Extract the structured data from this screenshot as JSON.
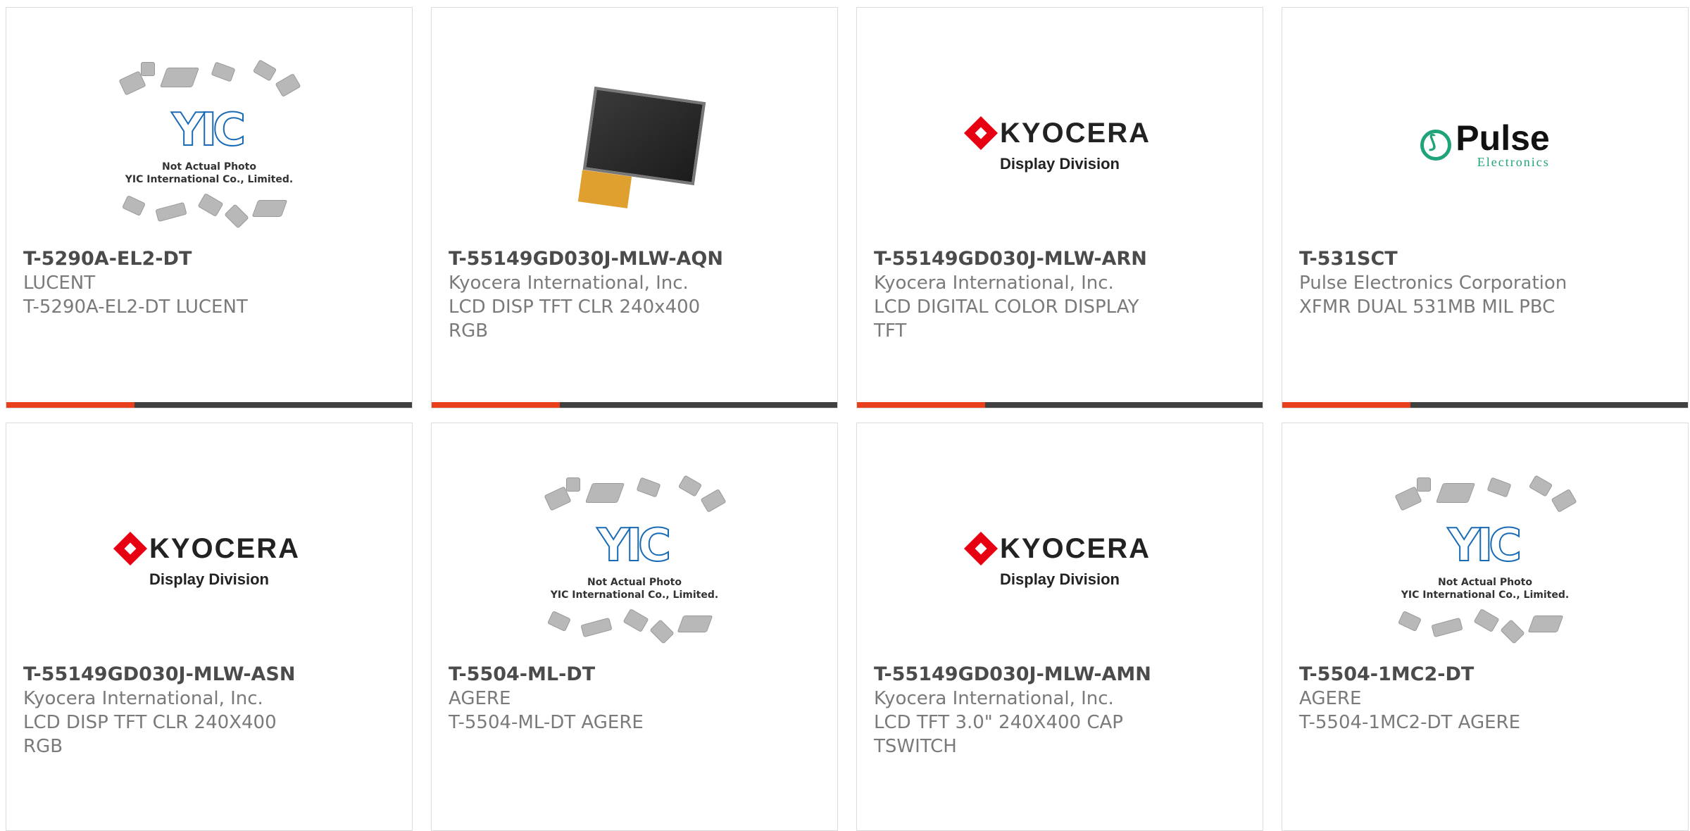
{
  "products": [
    {
      "part_number": "T-5290A-EL2-DT",
      "manufacturer": "LUCENT",
      "description": "T-5290A-EL2-DT LUCENT",
      "image": "yic-placeholder"
    },
    {
      "part_number": "T-55149GD030J-MLW-AQN",
      "manufacturer": "Kyocera International, Inc.",
      "description": "LCD DISP TFT CLR 240x400 RGB",
      "image": "lcd-photo"
    },
    {
      "part_number": "T-55149GD030J-MLW-ARN",
      "manufacturer": "Kyocera International, Inc.",
      "description": "LCD DIGITAL COLOR DISPLAY TFT",
      "image": "kyocera-logo"
    },
    {
      "part_number": "T-531SCT",
      "manufacturer": "Pulse Electronics Corporation",
      "description": "XFMR DUAL 531MB MIL PBC",
      "image": "pulse-logo"
    },
    {
      "part_number": "T-55149GD030J-MLW-ASN",
      "manufacturer": "Kyocera International, Inc.",
      "description": "LCD DISP TFT CLR 240X400 RGB",
      "image": "kyocera-logo"
    },
    {
      "part_number": "T-5504-ML-DT",
      "manufacturer": "AGERE",
      "description": "T-5504-ML-DT AGERE",
      "image": "yic-placeholder"
    },
    {
      "part_number": "T-55149GD030J-MLW-AMN",
      "manufacturer": "Kyocera International, Inc.",
      "description": "LCD TFT 3.0\" 240X400 CAP TSWITCH",
      "image": "kyocera-logo"
    },
    {
      "part_number": "T-5504-1MC2-DT",
      "manufacturer": "AGERE",
      "description": "T-5504-1MC2-DT AGERE",
      "image": "yic-placeholder"
    }
  ],
  "placeholder": {
    "letters": "YIC",
    "line1": "Not Actual Photo",
    "line2": "YIC International Co., Limited."
  },
  "kyocera": {
    "name": "KYOCERA",
    "division": "Display Division"
  },
  "pulse": {
    "name": "Pulse",
    "sub": "Electronics"
  },
  "colors": {
    "accent": "#e8401c",
    "bar": "#404040",
    "part_number": "#4b4b4b",
    "text": "#7a7a7a",
    "kyocera_red": "#e60012",
    "pulse_green": "#1fa37a",
    "yic_blue": "#1a6bb5"
  }
}
